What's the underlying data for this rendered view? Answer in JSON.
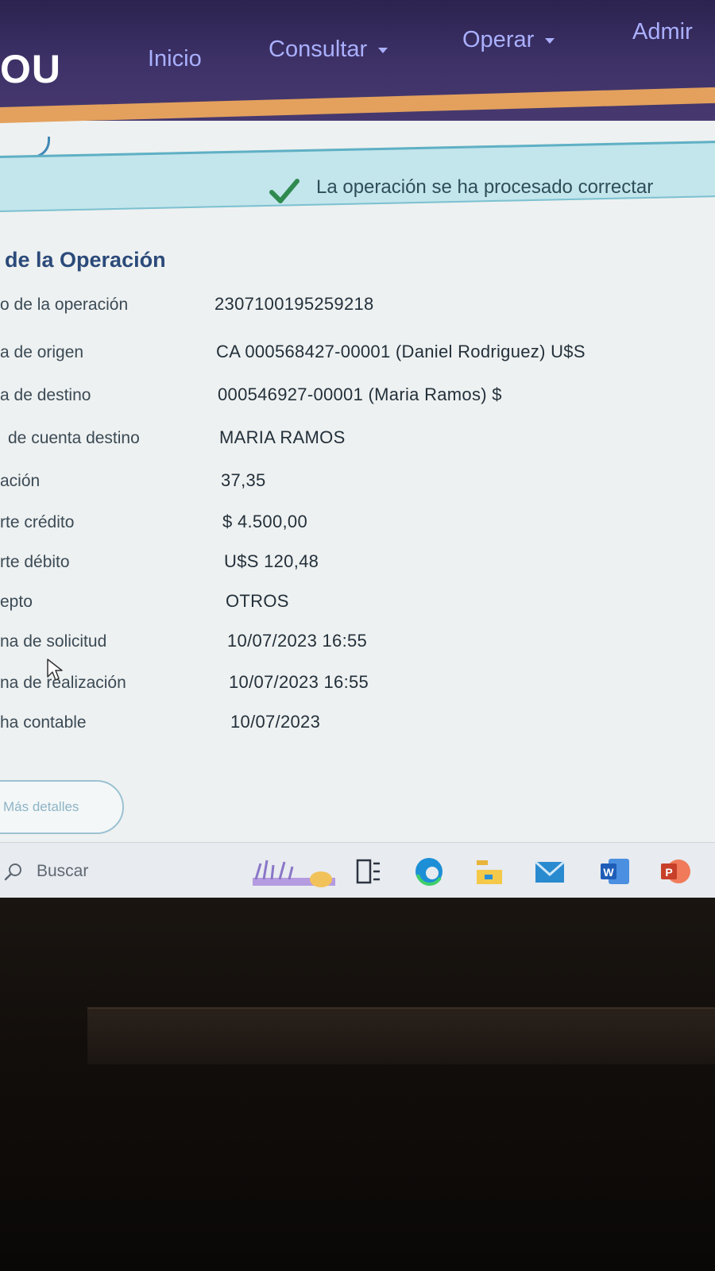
{
  "nav": {
    "logo": "OU",
    "items": [
      {
        "label": "Inicio"
      },
      {
        "label": "Consultar"
      },
      {
        "label": "Operar"
      },
      {
        "label": "Admir"
      }
    ]
  },
  "alert": {
    "message": "La operación se ha procesado correctar"
  },
  "section": {
    "title": "de la Operación"
  },
  "details": [
    {
      "label": "o de la operación",
      "value": "2307100195259218"
    },
    {
      "label": "a de origen",
      "value": "CA 000568427-00001 (Daniel Rodriguez) U$S"
    },
    {
      "label": "a de destino",
      "value": "000546927-00001 (Maria Ramos) $"
    },
    {
      "label": "de cuenta destino",
      "value": "MARIA RAMOS"
    },
    {
      "label": "ación",
      "value": "37,35"
    },
    {
      "label": "rte crédito",
      "value": "$ 4.500,00"
    },
    {
      "label": "rte débito",
      "value": "U$S 120,48"
    },
    {
      "label": "epto",
      "value": "OTROS"
    },
    {
      "label": "na de solicitud",
      "value": "10/07/2023 16:55"
    },
    {
      "label": "na de realización",
      "value": "10/07/2023 16:55"
    },
    {
      "label": "ha contable",
      "value": "10/07/2023"
    }
  ],
  "more_button": {
    "label": "Más detalles"
  },
  "taskbar": {
    "search_label": "Buscar",
    "icons": [
      "widgets-icon",
      "task-view-icon",
      "edge-icon",
      "file-explorer-icon",
      "mail-icon",
      "word-icon",
      "powerpoint-icon"
    ]
  },
  "colors": {
    "navbar": "#3e3268",
    "accent_stripe": "#e3a15d",
    "alert_bg": "#c3e5ec",
    "success_check": "#2f8a4f",
    "title": "#2b4a7a"
  }
}
